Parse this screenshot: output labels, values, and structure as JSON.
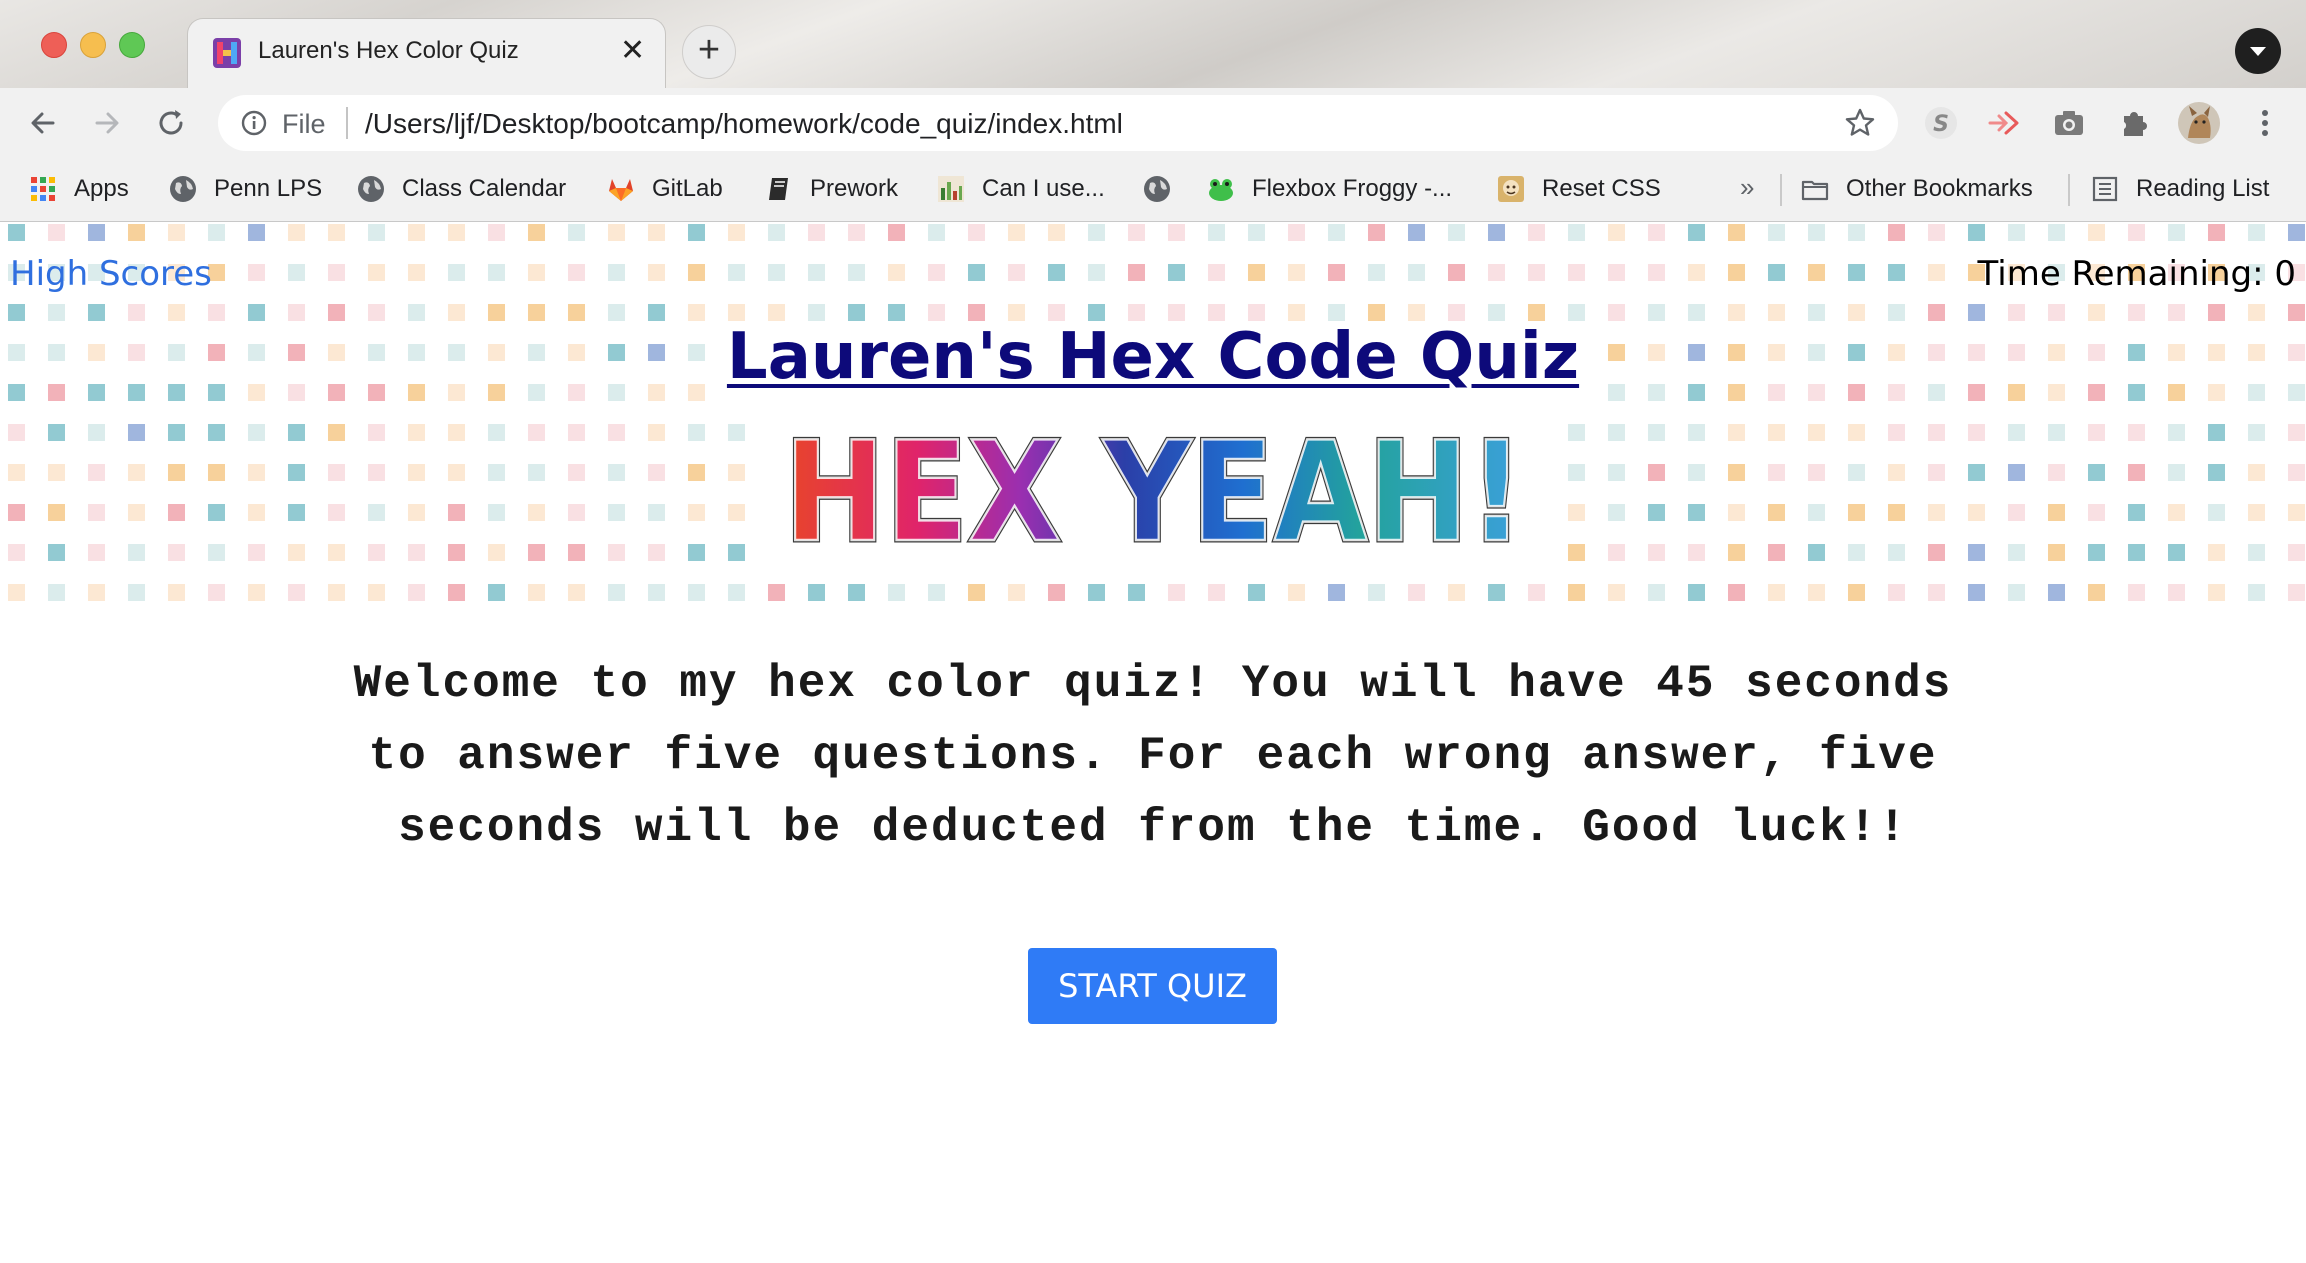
{
  "window": {
    "tab_title": "Lauren's Hex Color Quiz",
    "tab_close_glyph": "✕",
    "new_tab_glyph": "+",
    "icons": {
      "back": "arrow-left-icon",
      "forward": "arrow-right-icon",
      "reload": "reload-icon",
      "info": "info-icon",
      "star": "star-icon",
      "menu": "kebab-menu-icon"
    }
  },
  "omnibox": {
    "scheme": "File",
    "url": "/Users/ljf/Desktop/bootcamp/homework/code_quiz/index.html"
  },
  "bookmarks": {
    "items": [
      {
        "label": "Apps",
        "icon": "apps-grid-icon"
      },
      {
        "label": "Penn LPS",
        "icon": "globe-icon"
      },
      {
        "label": "Class Calendar",
        "icon": "globe-icon"
      },
      {
        "label": "GitLab",
        "icon": "gitlab-icon"
      },
      {
        "label": "Prework",
        "icon": "book-icon"
      },
      {
        "label": "Can I use...",
        "icon": "caniuse-icon"
      },
      {
        "label": "",
        "icon": "globe-icon"
      },
      {
        "label": "Flexbox Froggy -...",
        "icon": "frog-icon"
      },
      {
        "label": "Reset CSS",
        "icon": "reset-css-icon"
      }
    ],
    "overflow_glyph": "»",
    "other": "Other Bookmarks",
    "reading_list": "Reading List"
  },
  "page": {
    "high_scores": "High Scores",
    "time_label": "Time Remaining: ",
    "time_value": "0",
    "title": "Lauren's Hex Code Quiz",
    "logo_text": "HEX YEAH!",
    "welcome": "Welcome to my hex color quiz! You will have 45 seconds to answer five questions. For each wrong answer, five seconds will be deducted from the time. Good luck!!",
    "start_button": "START QUIZ",
    "colors": {
      "title": "#0d0a7a",
      "link": "#2f6fdf",
      "button": "#2f7bf6",
      "dot_palette": [
        "#7fc1ca",
        "#f0a4ad",
        "#f6c98a",
        "#8fa9d8",
        "#cfe5e6",
        "#fbe0c4",
        "#f7d5d9"
      ]
    }
  }
}
